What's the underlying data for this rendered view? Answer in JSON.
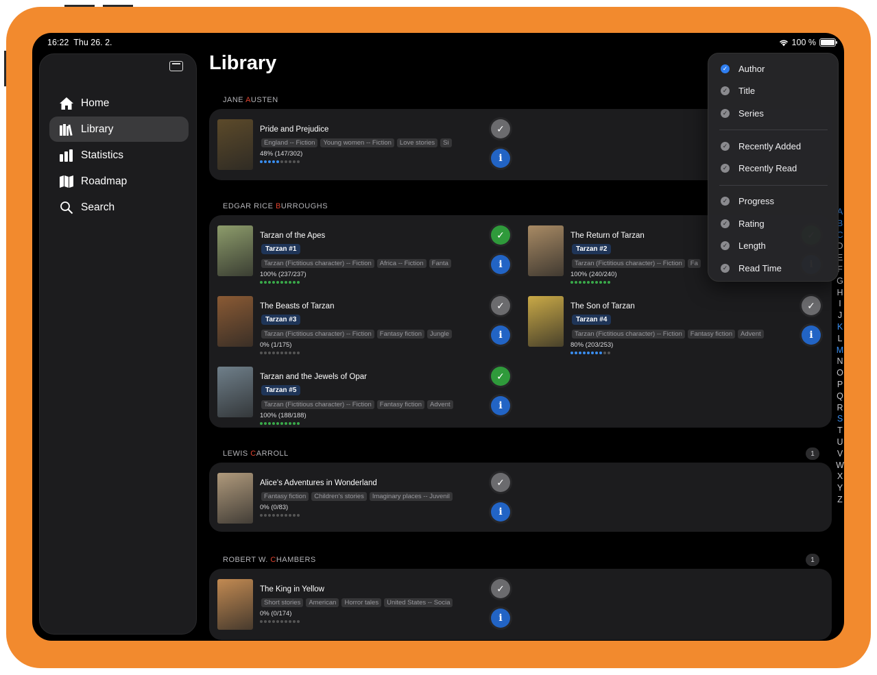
{
  "status": {
    "time": "16:22",
    "date": "Thu 26. 2.",
    "battery": "100 %"
  },
  "sidebar": {
    "items": [
      {
        "label": "Home",
        "icon": "house-icon"
      },
      {
        "label": "Library",
        "icon": "books-icon",
        "active": true
      },
      {
        "label": "Statistics",
        "icon": "bar-chart-icon"
      },
      {
        "label": "Roadmap",
        "icon": "map-icon"
      },
      {
        "label": "Search",
        "icon": "search-icon"
      }
    ]
  },
  "page_title": "Library",
  "sections": [
    {
      "author_pre": "JANE ",
      "author_hl": "A",
      "author_post": "USTEN",
      "books": [
        {
          "title": "Pride and Prejudice",
          "tags": [
            "England -- Fiction",
            "Young women -- Fiction",
            "Love stories",
            "Si"
          ],
          "progress": "48% (147/302)",
          "fraction": 0.48,
          "status": "grey",
          "cover_color": "#5c4a2a"
        }
      ]
    },
    {
      "author_pre": "EDGAR RICE ",
      "author_hl": "B",
      "author_post": "URROUGHS",
      "books": [
        {
          "title": "Tarzan of the Apes",
          "series": "Tarzan #1",
          "tags": [
            "Tarzan (Fictitious character) -- Fiction",
            "Africa -- Fiction",
            "Fanta"
          ],
          "progress": "100% (237/237)",
          "fraction": 1.0,
          "status": "green",
          "cover_color": "#8d9c6b"
        },
        {
          "title": "The Return of Tarzan",
          "series": "Tarzan #2",
          "tags": [
            "Tarzan (Fictitious character) -- Fiction",
            "Fa"
          ],
          "progress": "100% (240/240)",
          "fraction": 1.0,
          "status": "green",
          "cover_color": "#a88a64"
        },
        {
          "title": "The Beasts of Tarzan",
          "series": "Tarzan #3",
          "tags": [
            "Tarzan (Fictitious character) -- Fiction",
            "Fantasy fiction",
            "Jungle"
          ],
          "progress": "0% (1/175)",
          "fraction": 0.0,
          "status": "grey",
          "cover_color": "#8a5a34"
        },
        {
          "title": "The Son of Tarzan",
          "series": "Tarzan #4",
          "tags": [
            "Tarzan (Fictitious character) -- Fiction",
            "Fantasy fiction",
            "Advent"
          ],
          "progress": "80% (203/253)",
          "fraction": 0.8,
          "status": "grey",
          "cover_color": "#c9a947"
        },
        {
          "title": "Tarzan and the Jewels of Opar",
          "series": "Tarzan #5",
          "tags": [
            "Tarzan (Fictitious character) -- Fiction",
            "Fantasy fiction",
            "Advent"
          ],
          "progress": "100% (188/188)",
          "fraction": 1.0,
          "status": "green",
          "cover_color": "#6f7f8a"
        }
      ]
    },
    {
      "author_pre": "LEWIS ",
      "author_hl": "C",
      "author_post": "ARROLL",
      "count": "1",
      "books": [
        {
          "title": "Alice's Adventures in Wonderland",
          "tags": [
            "Fantasy fiction",
            "Children's stories",
            "Imaginary places -- Juvenil"
          ],
          "progress": "0% (0/83)",
          "fraction": 0.0,
          "status": "grey",
          "cover_color": "#b09a7c"
        }
      ]
    },
    {
      "author_pre": "ROBERT W. ",
      "author_hl": "C",
      "author_post": "HAMBERS",
      "count": "1",
      "books": [
        {
          "title": "The King in Yellow",
          "tags": [
            "Short stories",
            "American",
            "Horror tales",
            "United States -- Socia"
          ],
          "progress": "0% (0/174)",
          "fraction": 0.0,
          "status": "grey",
          "cover_color": "#c28a52"
        }
      ]
    }
  ],
  "alphabet": [
    "A",
    "B",
    "C",
    "D",
    "E",
    "F",
    "G",
    "H",
    "I",
    "J",
    "K",
    "L",
    "M",
    "N",
    "O",
    "P",
    "Q",
    "R",
    "S",
    "T",
    "U",
    "V",
    "W",
    "X",
    "Y",
    "Z"
  ],
  "alphabet_highlight": [
    "A",
    "B",
    "C",
    "K",
    "M",
    "S"
  ],
  "sort_menu": {
    "groups": [
      [
        {
          "label": "Author",
          "selected": true
        },
        {
          "label": "Title"
        },
        {
          "label": "Series"
        }
      ],
      [
        {
          "label": "Recently Added"
        },
        {
          "label": "Recently Read"
        }
      ],
      [
        {
          "label": "Progress"
        },
        {
          "label": "Rating"
        },
        {
          "label": "Length"
        },
        {
          "label": "Read Time"
        }
      ]
    ]
  },
  "colors": {
    "case": "#F28A2E",
    "accent": "#2f7ef0",
    "done": "#2f9a3b",
    "info": "#2264c5"
  }
}
